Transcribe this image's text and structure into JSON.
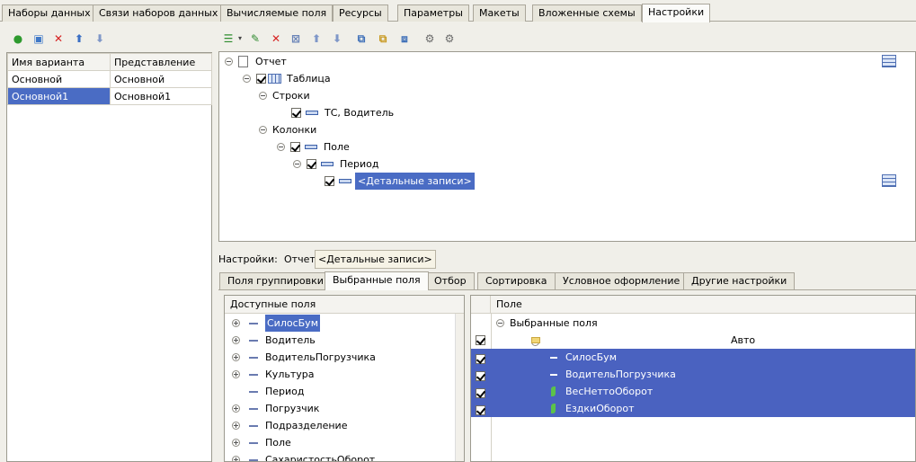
{
  "top_tabs": [
    "Наборы данных",
    "Связи наборов данных",
    "Вычисляемые поля",
    "Ресурсы",
    "Параметры",
    "Макеты",
    "Вложенные схемы",
    "Настройки"
  ],
  "variants": {
    "headers": [
      "Имя варианта",
      "Представление"
    ],
    "rows": [
      {
        "name": "Основной",
        "repr": "Основной"
      },
      {
        "name": "Основной1",
        "repr": "Основной1"
      }
    ]
  },
  "structure_tree": {
    "report": "Отчет",
    "table": "Таблица",
    "rows": "Строки",
    "rows_item": "ТС, Водитель",
    "columns": "Колонки",
    "field": "Поле",
    "period": "Период",
    "details": "<Детальные записи>"
  },
  "settings_bar": {
    "label": "Настройки:",
    "report": "Отчет",
    "details": "<Детальные записи>"
  },
  "settings_tabs": [
    "Поля группировки",
    "Выбранные поля",
    "Отбор",
    "Сортировка",
    "Условное оформление",
    "Другие настройки"
  ],
  "available_fields": {
    "header": "Доступные поля",
    "items": [
      "СилосБум",
      "Водитель",
      "ВодительПогрузчика",
      "Культура",
      "Период",
      "Погрузчик",
      "Подразделение",
      "Поле",
      "СахаристостьОборот"
    ]
  },
  "selected_fields": {
    "header": "Поле",
    "root": "Выбранные поля",
    "group": "Авто",
    "items": [
      "СилосБум",
      "ВодительПогрузчика",
      "ВесНеттоОборот",
      "ЕздкиОборот"
    ]
  },
  "colors": {
    "selection": "#4a62c0",
    "background": "#f0efe9"
  }
}
